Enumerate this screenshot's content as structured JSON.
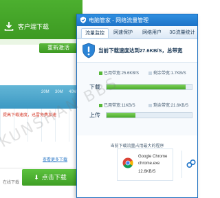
{
  "background_page": {
    "header_title": "客户端下载",
    "reinstall_button": "重新激活",
    "chart_ticks": [
      "20M",
      "30M",
      "40M"
    ],
    "red_note": "提高下载速度，迅雷免费加速",
    "link_text": "查看更多下载",
    "download_button": "点击下载",
    "footer_small": "在线下载"
  },
  "monitor_window": {
    "title": "电脑管家 - 网络流量管理",
    "tabs": [
      "流量监控",
      "网速保护",
      "网络用户",
      "3G流量统计"
    ],
    "active_tab_index": 0,
    "status_text": "当前下载速度达到27.6KB/S，总带宽",
    "download": {
      "label": "下载",
      "used_legend": "已用带宽:25.6KB/S",
      "free_legend": "剩余带宽:1.7KB/S",
      "used_fraction": 0.93
    },
    "upload": {
      "label": "上传",
      "used_legend": "已用带宽:11KB/S",
      "free_legend": "剩余带宽:21.6KB/S",
      "used_fraction": 0.34
    },
    "hint_text": "当前下载流量占用最大的程序",
    "process": {
      "name": "Google Chrome",
      "exe": "chrome.exe",
      "speed": "12.6KB/S"
    }
  },
  "watermark_text": "KUNSHAN BBS",
  "colors": {
    "green": "#4aa92b",
    "blue_titlebar": "#1e73c7",
    "text_dark": "#1d3a57"
  }
}
